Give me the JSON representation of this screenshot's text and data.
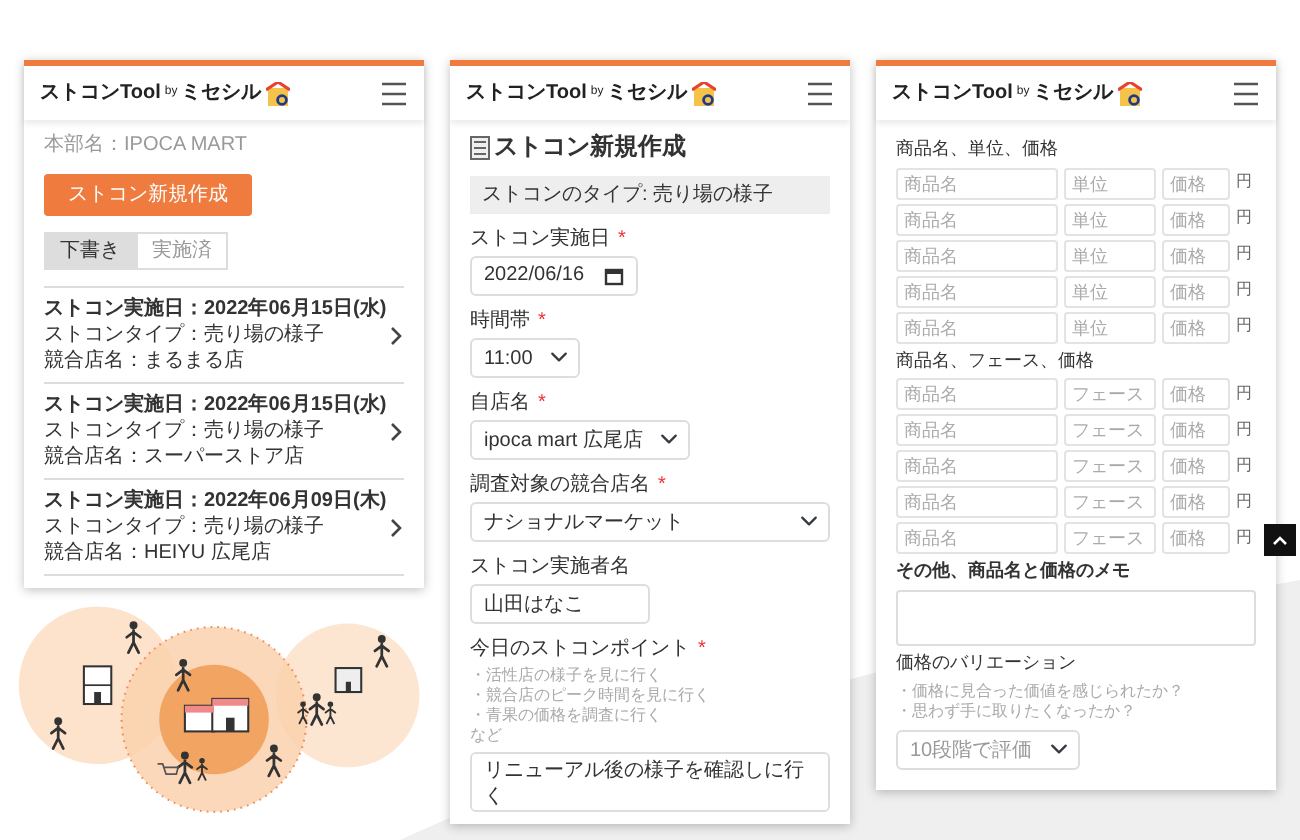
{
  "list_screen": {
    "logo": {
      "main": "ストコンTool",
      "by": "by",
      "brand": "ミセシル"
    },
    "store_label": "本部名：IPOCA MART",
    "create_button": "ストコン新規作成",
    "tabs": [
      {
        "label": "下書き",
        "selected": true
      },
      {
        "label": "実施済",
        "selected": false
      }
    ],
    "entries": [
      {
        "date": "ストコン実施日：2022年06月15日(水)",
        "type": "ストコンタイプ：売り場の様子",
        "competitor": "競合店名：まるまる店"
      },
      {
        "date": "ストコン実施日：2022年06月15日(水)",
        "type": "ストコンタイプ：売り場の様子",
        "competitor": "競合店名：スーパーストア店"
      },
      {
        "date": "ストコン実施日：2022年06月09日(木)",
        "type": "ストコンタイプ：売り場の様子",
        "competitor": "競合店名：HEIYU 広尾店"
      }
    ]
  },
  "form_screen": {
    "logo": {
      "main": "ストコンTool",
      "by": "by",
      "brand": "ミセシル"
    },
    "title": "ストコン新規作成",
    "type_note": "ストコンのタイプ: 売り場の様子",
    "fields": [
      {
        "kind": "date",
        "label": "ストコン実施日",
        "marker": "*",
        "value": "2022/06/16"
      },
      {
        "kind": "select",
        "label": "時間帯",
        "marker": "*",
        "value": "11:00"
      },
      {
        "kind": "select",
        "label": "自店名",
        "marker": "*",
        "value": "ipoca mart 広尾店"
      },
      {
        "kind": "wide-select",
        "label": "調査対象の競合店名",
        "marker": "*",
        "value": "ナショナルマーケット"
      },
      {
        "kind": "text",
        "label": "ストコン実施者名",
        "value": "山田はなこ"
      },
      {
        "kind": "textarea",
        "label": "今日のストコンポイント",
        "marker": "*",
        "hints": [
          "・活性店の様子を見に行く",
          "・競合店のピーク時間を見に行く",
          "・青果の価格を調査に行く",
          "など"
        ],
        "value": "リニューアル後の様子を確認しに行く"
      }
    ]
  },
  "price_screen": {
    "logo": {
      "main": "ストコンTool",
      "by": "by",
      "brand": "ミセシル"
    },
    "sections": [
      {
        "label": "商品名、単位、価格",
        "rows": [
          {
            "placeholders": [
              "商品名",
              "単位",
              "価格"
            ],
            "suffix": "円"
          },
          {
            "placeholders": [
              "商品名",
              "単位",
              "価格"
            ],
            "suffix": "円"
          },
          {
            "placeholders": [
              "商品名",
              "単位",
              "価格"
            ],
            "suffix": "円"
          },
          {
            "placeholders": [
              "商品名",
              "単位",
              "価格"
            ],
            "suffix": "円"
          },
          {
            "placeholders": [
              "商品名",
              "単位",
              "価格"
            ],
            "suffix": "円"
          }
        ]
      },
      {
        "label": "商品名、フェース、価格",
        "rows": [
          {
            "placeholders": [
              "商品名",
              "フェース",
              "価格"
            ],
            "suffix": "円"
          },
          {
            "placeholders": [
              "商品名",
              "フェース",
              "価格"
            ],
            "suffix": "円"
          },
          {
            "placeholders": [
              "商品名",
              "フェース",
              "価格"
            ],
            "suffix": "円"
          },
          {
            "placeholders": [
              "商品名",
              "フェース",
              "価格"
            ],
            "suffix": "円"
          },
          {
            "placeholders": [
              "商品名",
              "フェース",
              "価格"
            ],
            "suffix": "円"
          }
        ]
      }
    ],
    "memo_label": "その他、商品名と価格のメモ",
    "variation": {
      "label": "価格のバリエーション",
      "hints": [
        "・価格に見合った価値を感じられたか？",
        "・思わず手に取りたくなったか？"
      ],
      "select": "10段階で評価"
    }
  }
}
